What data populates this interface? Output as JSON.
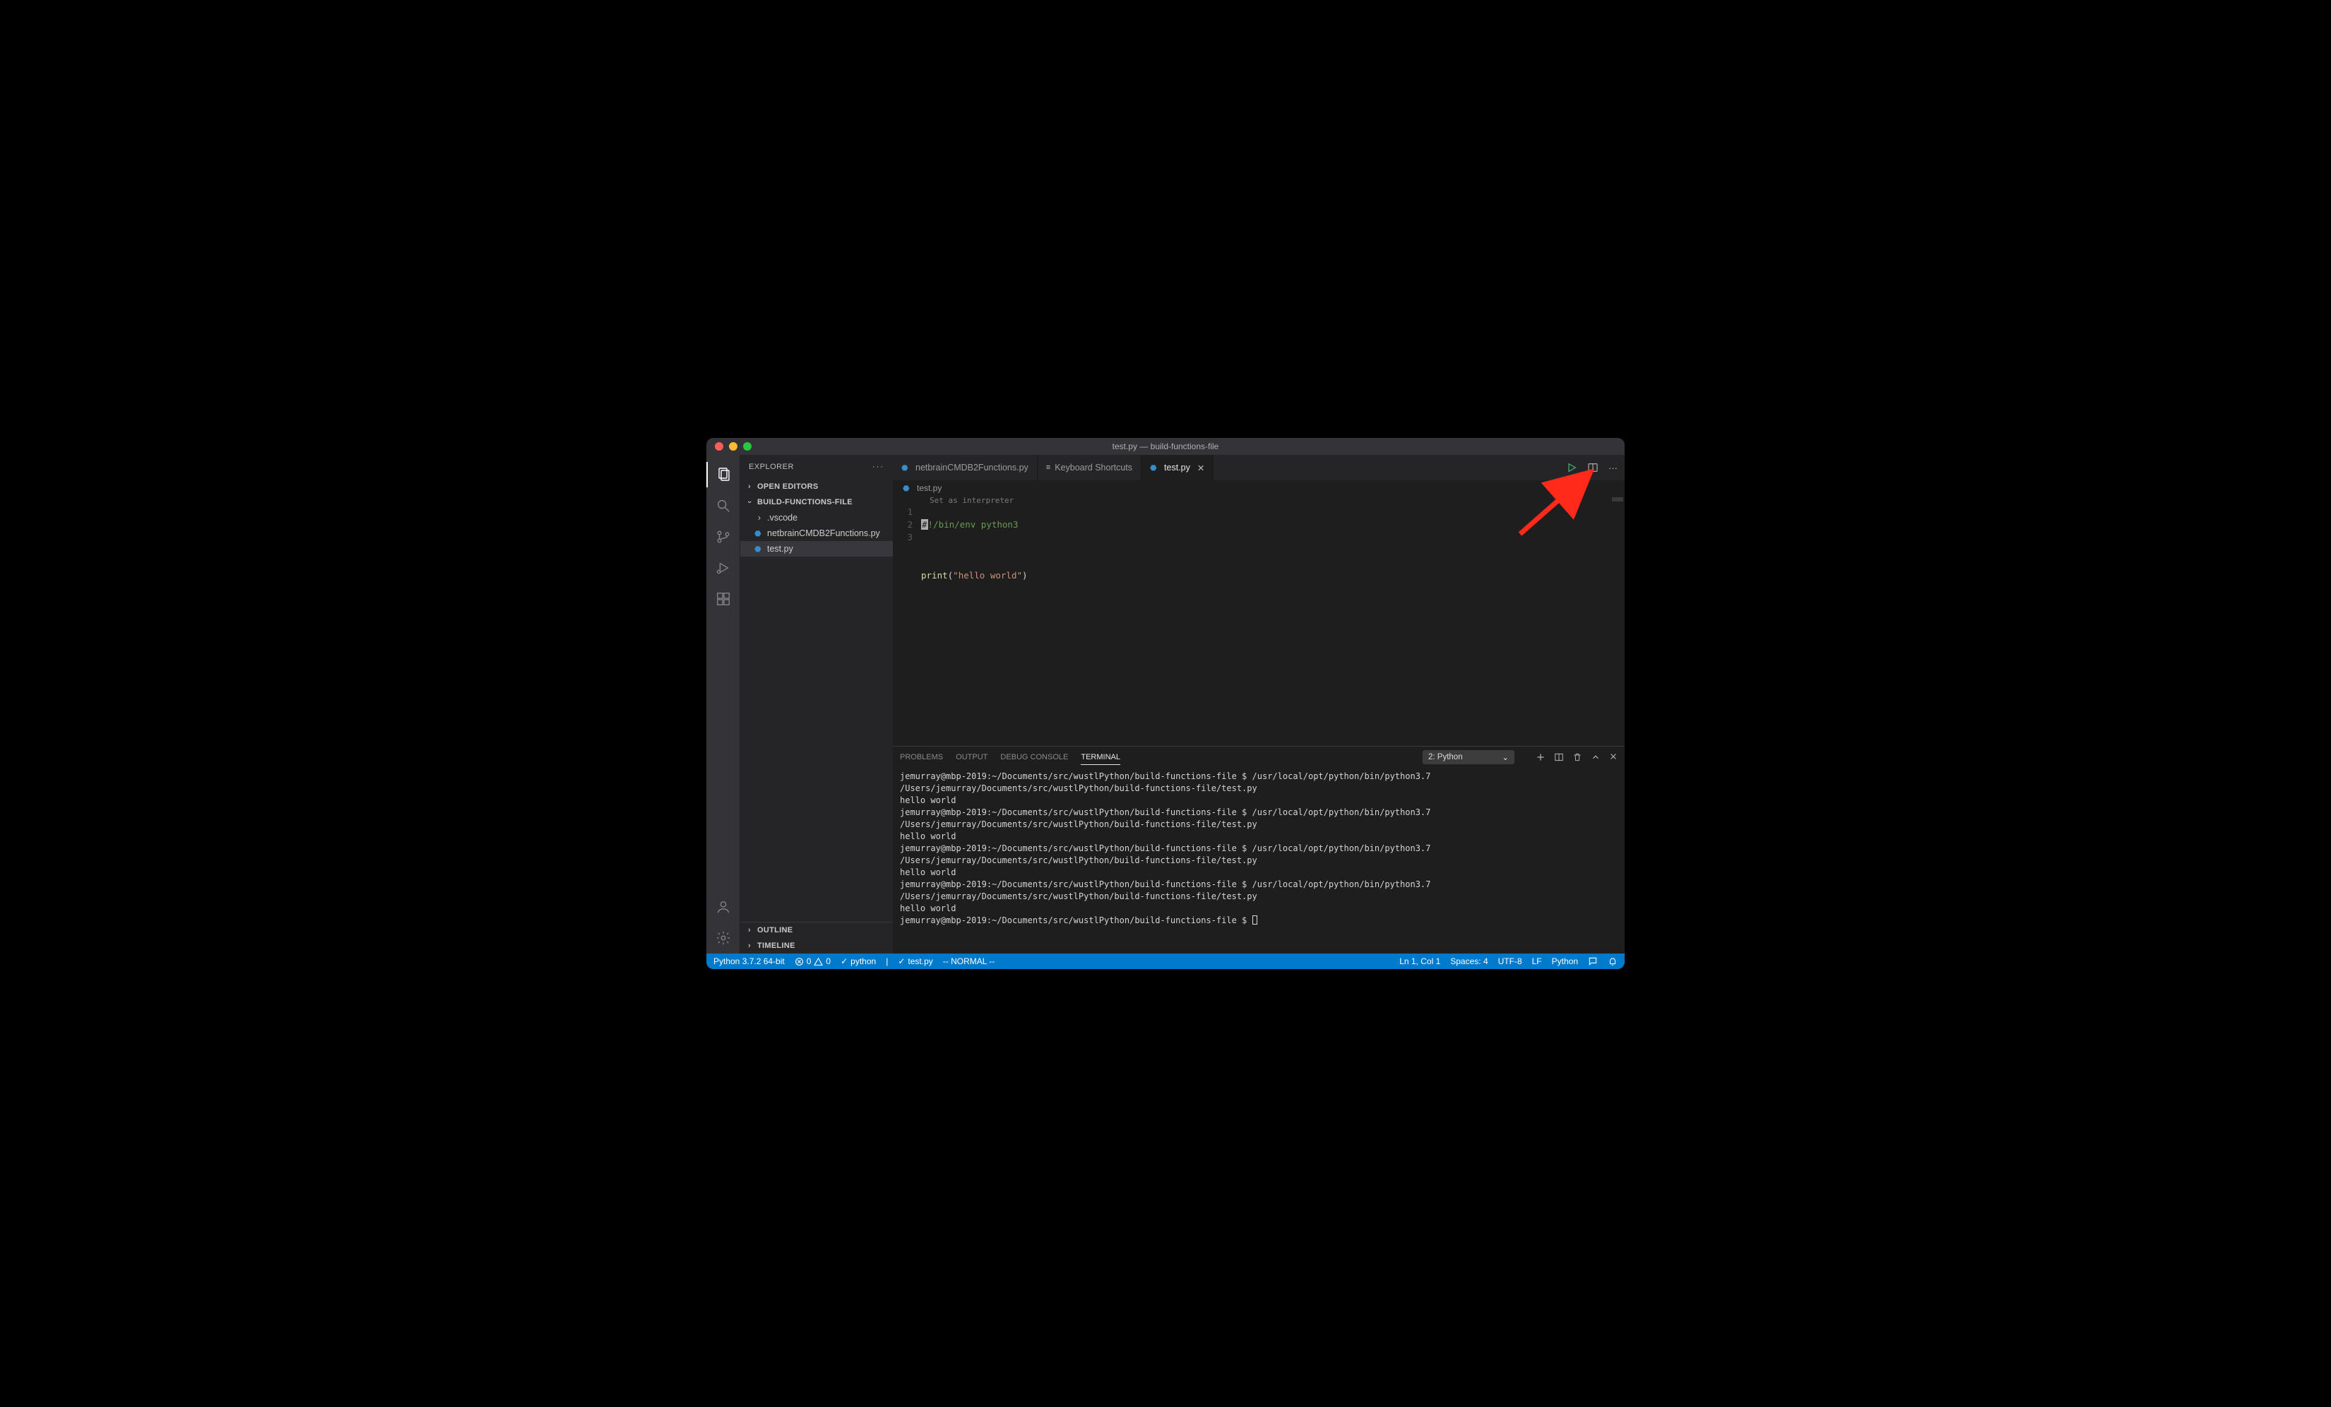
{
  "title": "test.py — build-functions-file",
  "sidebar": {
    "header": "EXPLORER",
    "open_editors": "OPEN EDITORS",
    "folder": "BUILD-FUNCTIONS-FILE",
    "items": [
      {
        "label": ".vscode",
        "type": "folder"
      },
      {
        "label": "netbrainCMDB2Functions.py",
        "type": "py"
      },
      {
        "label": "test.py",
        "type": "py",
        "selected": true
      }
    ],
    "outline": "OUTLINE",
    "timeline": "TIMELINE"
  },
  "tabs": [
    {
      "label": "netbrainCMDB2Functions.py",
      "type": "py"
    },
    {
      "label": "Keyboard Shortcuts",
      "type": "kb"
    },
    {
      "label": "test.py",
      "type": "py",
      "active": true
    }
  ],
  "breadcrumb": {
    "file": "test.py"
  },
  "editor": {
    "hint": "Set as interpreter",
    "lines": [
      1,
      2,
      3
    ],
    "shebang_prefix": "#",
    "shebang_rest": "!/bin/env python3",
    "print_fn": "print",
    "print_open": "(",
    "print_str": "\"hello world\"",
    "print_close": ")"
  },
  "panel": {
    "tabs": {
      "problems": "PROBLEMS",
      "output": "OUTPUT",
      "debug": "DEBUG CONSOLE",
      "terminal": "TERMINAL"
    },
    "select": "2: Python",
    "prompt": "jemurray@mbp-2019:~/Documents/src/wustlPython/build-functions-file $",
    "cmd": "/usr/local/opt/python/bin/python3.7 /Users/jemurray/Documents/src/wustlPython/build-functions-file/test.py",
    "out": "hello world"
  },
  "status": {
    "interpreter": "Python 3.7.2 64-bit",
    "errors": "0",
    "warnings": "0",
    "lint": "python",
    "lint2": "test.py",
    "mode": "-- NORMAL --",
    "pos": "Ln 1, Col 1",
    "spaces": "Spaces: 4",
    "enc": "UTF-8",
    "eol": "LF",
    "lang": "Python"
  }
}
